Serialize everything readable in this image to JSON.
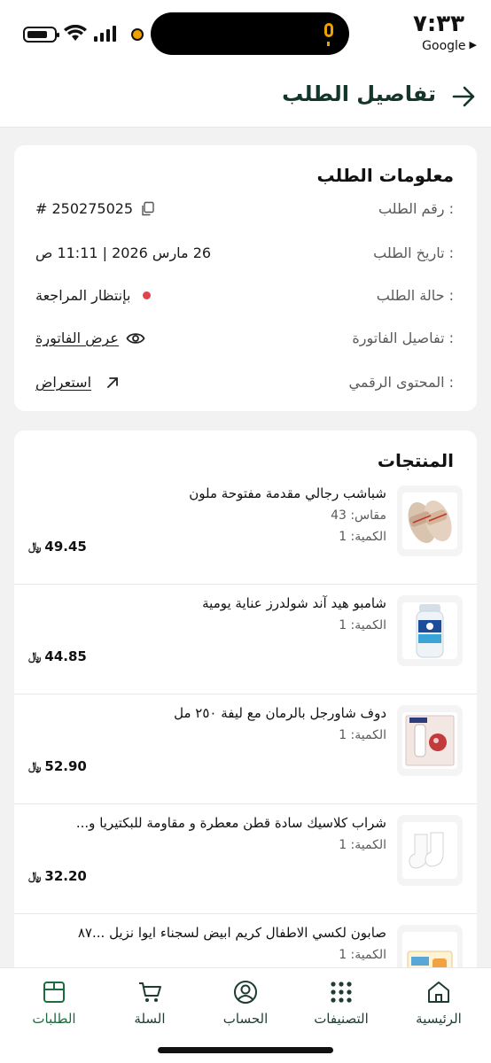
{
  "status_bar": {
    "time": "٧:٣٣",
    "carrier": "Google",
    "carrier_arrow": "▶"
  },
  "header": {
    "title": "تفاصيل الطلب",
    "back_icon": "arrow-right-icon"
  },
  "order_info": {
    "title": "معلومات الطلب",
    "order_number_label": "رقم الطلب :",
    "order_number_value": "# 250275025",
    "order_date_label": "تاريخ الطلب :",
    "order_date_value": "26 مارس 2026 | 11:11 ص",
    "order_status_label": "حالة الطلب :",
    "order_status_value": "بإنتظار المراجعة",
    "invoice_label": "تفاصيل الفاتورة :",
    "invoice_link": "عرض الفاتورة",
    "digital_label": "المحتوى الرقمي :",
    "digital_link": "استعراض",
    "status_color": "#e0434b"
  },
  "products": {
    "title": "المنتجات",
    "items": [
      {
        "name": "شباشب رجالي مقدمة مفتوحة ملون",
        "size": "مقاس: 43",
        "qty": "الكمية: 1",
        "price": "49.45"
      },
      {
        "name": "شامبو هيد آند شولدرز عناية يومية",
        "size": "",
        "qty": "الكمية: 1",
        "price": "44.85"
      },
      {
        "name": "دوف شاورجل بالرمان مع ليفة ٢٥٠ مل",
        "size": "",
        "qty": "الكمية: 1",
        "price": "52.90"
      },
      {
        "name": "شراب كلاسيك سادة قطن معطرة و مقاومة للبكتيريا و...",
        "size": "",
        "qty": "الكمية: 1",
        "price": "32.20"
      },
      {
        "name": "صابون لكسي الاطفال كريم ابيض لسجناء ايوا نزيل ...٨٧",
        "size": "",
        "qty": "الكمية: 1",
        "price": ""
      }
    ],
    "currency_symbol": "﷼"
  },
  "bottom_nav": {
    "items": [
      {
        "label": "الرئيسية",
        "icon": "home-icon"
      },
      {
        "label": "التصنيفات",
        "icon": "grid-icon"
      },
      {
        "label": "الحساب",
        "icon": "user-icon"
      },
      {
        "label": "السلة",
        "icon": "cart-icon"
      },
      {
        "label": "الطلبات",
        "icon": "box-icon"
      }
    ],
    "active": "الطلبات",
    "accent_color": "#1d6b3e"
  }
}
